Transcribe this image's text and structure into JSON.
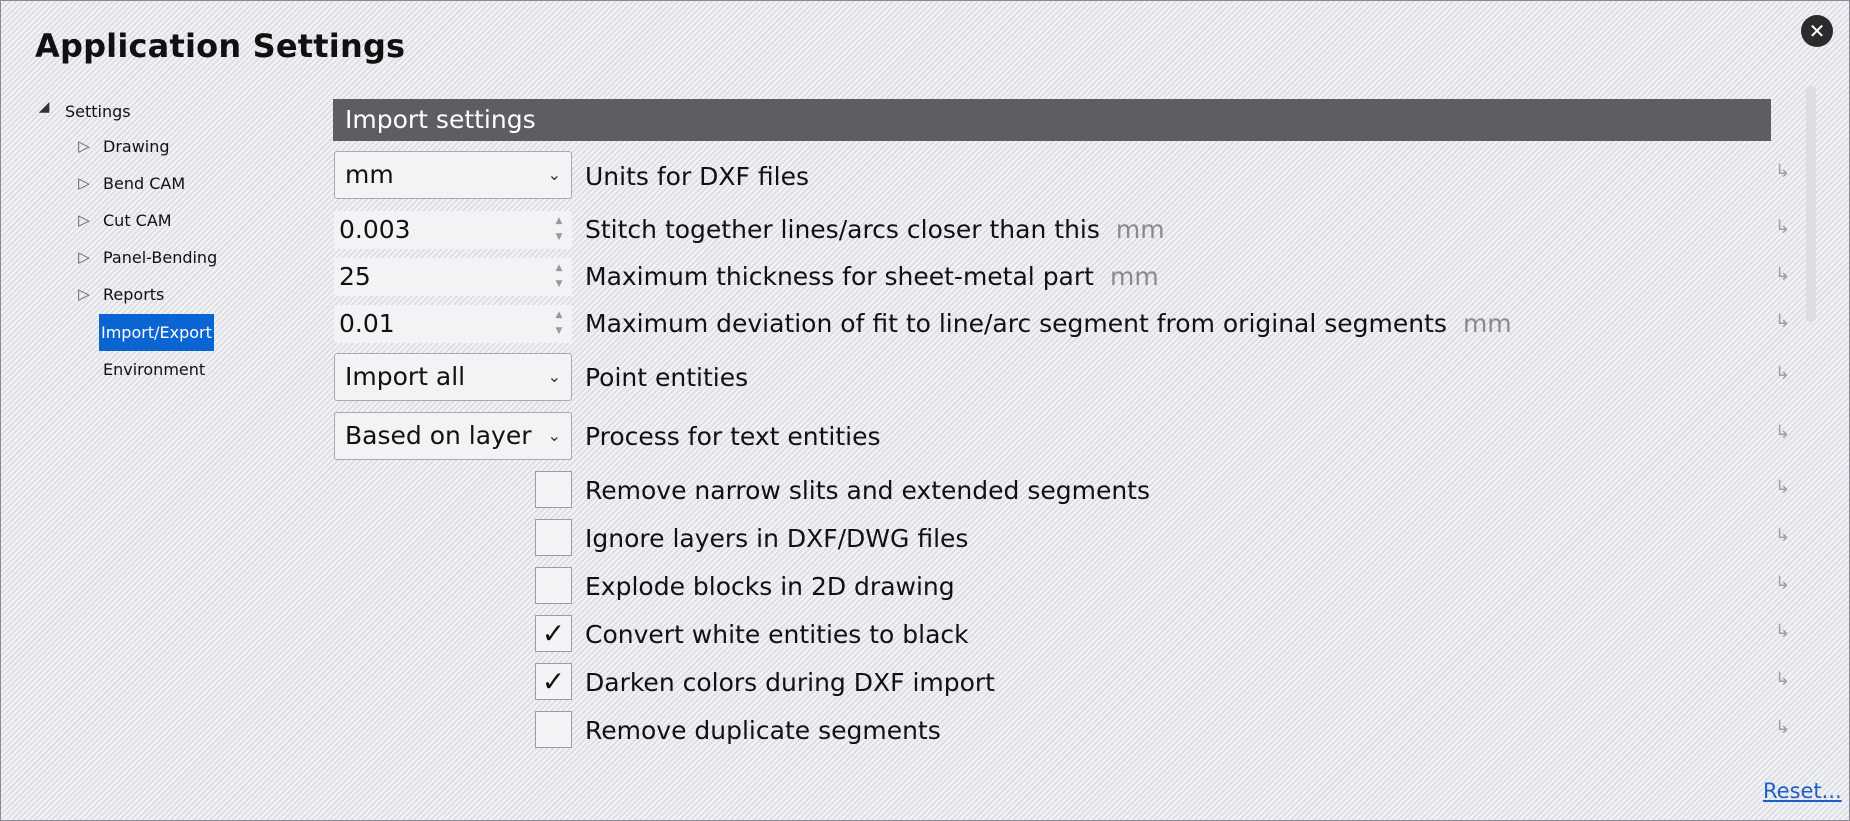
{
  "window": {
    "title": "Application Settings",
    "close_icon": "close-icon"
  },
  "tree": {
    "root": "Settings",
    "items": [
      {
        "label": "Drawing",
        "expandable": true
      },
      {
        "label": "Bend CAM",
        "expandable": true
      },
      {
        "label": "Cut CAM",
        "expandable": true
      },
      {
        "label": "Panel-Bending",
        "expandable": true
      },
      {
        "label": "Reports",
        "expandable": true
      },
      {
        "label": "Import/Export",
        "expandable": false,
        "selected": true
      },
      {
        "label": "Environment",
        "expandable": false
      }
    ]
  },
  "section": {
    "title": "Import settings"
  },
  "settings": {
    "units_dxf": {
      "value": "mm",
      "label": "Units for DXF files"
    },
    "stitch": {
      "value": "0.003",
      "label": "Stitch together lines/arcs closer than this",
      "unit": "mm"
    },
    "max_thickness": {
      "value": "25",
      "label": "Maximum thickness for sheet-metal part",
      "unit": "mm"
    },
    "max_deviation": {
      "value": "0.01",
      "label": "Maximum deviation of fit to line/arc segment from original segments",
      "unit": "mm"
    },
    "point_entities": {
      "value": "Import all",
      "label": "Point entities"
    },
    "text_entities": {
      "value": "Based on layer",
      "label": "Process for text entities"
    },
    "checkboxes": [
      {
        "label": "Remove narrow slits and extended segments",
        "checked": false
      },
      {
        "label": "Ignore layers in DXF/DWG files",
        "checked": false
      },
      {
        "label": "Explode blocks in 2D drawing",
        "checked": false
      },
      {
        "label": "Convert white entities to black",
        "checked": true
      },
      {
        "label": "Darken colors during DXF import",
        "checked": true
      },
      {
        "label": "Remove duplicate segments",
        "checked": false
      }
    ]
  },
  "footer": {
    "reset_label": "Reset..."
  },
  "glyphs": {
    "chevron": "⌄",
    "check": "✓",
    "reset_arrow": "↳",
    "close": "✕",
    "spin_up": "▲",
    "spin_down": "▼",
    "tree_open": "◢",
    "tree_closed": "▷"
  },
  "colors": {
    "header_bar": "#5d5e63",
    "selection": "#0a64d2",
    "link": "#1a5fc8"
  }
}
